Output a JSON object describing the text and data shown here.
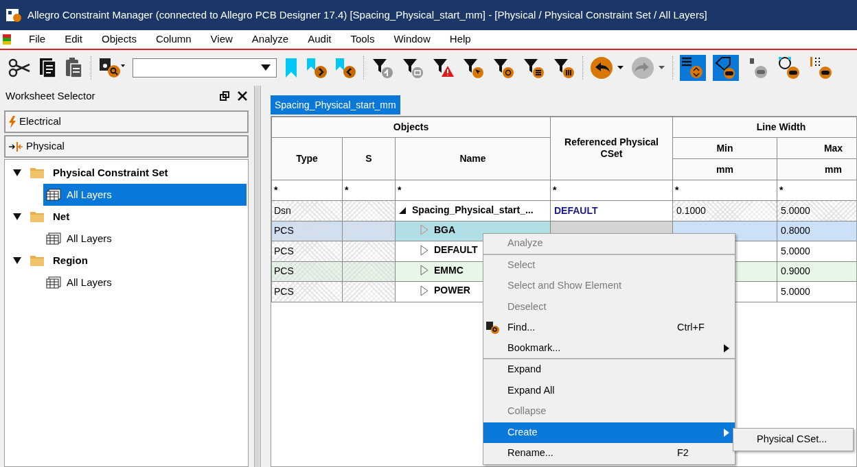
{
  "window": {
    "title": "Allegro Constraint Manager (connected to Allegro PCB Designer 17.4) [Spacing_Physical_start_mm] - [Physical / Physical Constraint Set / All Layers]"
  },
  "menu": [
    "File",
    "Edit",
    "Objects",
    "Column",
    "View",
    "Analyze",
    "Audit",
    "Tools",
    "Window",
    "Help"
  ],
  "worksheet_selector": {
    "title": "Worksheet Selector",
    "categories": [
      {
        "label": "Electrical",
        "kind": "electrical"
      },
      {
        "label": "Physical",
        "kind": "physical"
      }
    ],
    "tree": [
      {
        "label": "Physical Constraint Set",
        "expanded": true,
        "selected": false,
        "children": [
          {
            "label": "All Layers",
            "selected": true
          }
        ]
      },
      {
        "label": "Net",
        "expanded": true,
        "selected": false,
        "children": [
          {
            "label": "All Layers",
            "selected": false
          }
        ]
      },
      {
        "label": "Region",
        "expanded": true,
        "selected": false,
        "children": [
          {
            "label": "All Layers",
            "selected": false
          }
        ]
      }
    ]
  },
  "worksheet_tab": {
    "label": "Spacing_Physical_start_mm",
    "selected": true
  },
  "table": {
    "group_headers": [
      "Objects",
      "Referenced Physical CSet",
      "Line Width"
    ],
    "columns": [
      "Type",
      "S",
      "Name",
      "Min",
      "Max"
    ],
    "units": [
      "mm",
      "mm"
    ],
    "filters": [
      "*",
      "*",
      "*",
      "*",
      "*",
      "*"
    ],
    "rows": [
      {
        "type": "Dsn",
        "s": "",
        "name": "Spacing_Physical_start_...",
        "cset": "DEFAULT",
        "min": "0.1000",
        "max": "5.0000",
        "expanded": true,
        "selected": false,
        "color": "#ffffff",
        "children": [
          {
            "type": "PCS",
            "name": "BGA",
            "max": "0.8000",
            "expanded": false,
            "selected": true,
            "color": "#cce0f7"
          },
          {
            "type": "PCS",
            "name": "DEFAULT",
            "max": "5.0000",
            "expanded": false,
            "selected": false,
            "color": "#ffffff"
          },
          {
            "type": "PCS",
            "name": "EMMC",
            "max": "0.9000",
            "expanded": false,
            "selected": false,
            "color": "#e8f6e8"
          },
          {
            "type": "PCS",
            "name": "POWER",
            "max": "5.0000",
            "expanded": false,
            "selected": false,
            "color": "#ffffff"
          }
        ]
      }
    ]
  },
  "context_menu": {
    "items": [
      {
        "label": "Analyze",
        "disabled": true,
        "selected": false,
        "separator_after": true
      },
      {
        "label": "Select",
        "disabled": true,
        "selected": false
      },
      {
        "label": "Select and Show Element",
        "disabled": true,
        "selected": false
      },
      {
        "label": "Deselect",
        "disabled": true,
        "selected": false
      },
      {
        "label": "Find...",
        "shortcut": "Ctrl+F",
        "disabled": false,
        "selected": false,
        "has_icon": true
      },
      {
        "label": "Bookmark...",
        "disabled": false,
        "selected": false,
        "submenu": true,
        "separator_after": true
      },
      {
        "label": "Expand",
        "disabled": false,
        "selected": false
      },
      {
        "label": "Expand All",
        "disabled": false,
        "selected": false
      },
      {
        "label": "Collapse",
        "disabled": true,
        "selected": false
      },
      {
        "label": "Create",
        "disabled": false,
        "submenu": true,
        "selected": true
      },
      {
        "label": "Rename...",
        "shortcut": "F2",
        "disabled": false,
        "selected": false
      }
    ],
    "submenu": {
      "items": [
        "Physical CSet..."
      ]
    }
  }
}
